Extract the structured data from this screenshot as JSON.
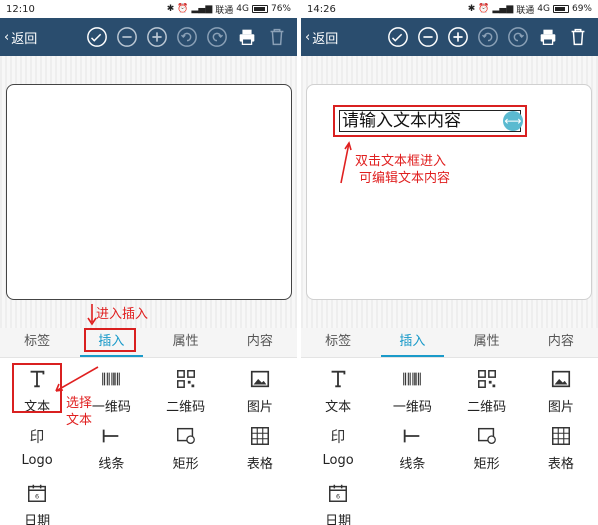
{
  "left": {
    "status": {
      "time": "12:10",
      "carrier": "联通",
      "net": "4G",
      "battery": "76%",
      "battery_level": 0.76
    },
    "topbar": {
      "back_label": "返回"
    },
    "tabs": [
      "标签",
      "插入",
      "属性",
      "内容"
    ],
    "active_tab": 1,
    "items": [
      "文本",
      "一维码",
      "二维码",
      "图片",
      "Logo",
      "线条",
      "矩形",
      "表格",
      "日期"
    ],
    "annotations": {
      "enter_insert": "进入插入",
      "select_text_line1": "选择",
      "select_text_line2": "文本"
    }
  },
  "right": {
    "status": {
      "time": "14:26",
      "carrier": "联通",
      "net": "4G",
      "battery": "69%",
      "battery_level": 0.69
    },
    "topbar": {
      "back_label": "返回"
    },
    "tabs": [
      "标签",
      "插入",
      "属性",
      "内容"
    ],
    "active_tab": 1,
    "items": [
      "文本",
      "一维码",
      "二维码",
      "图片",
      "Logo",
      "线条",
      "矩形",
      "表格",
      "日期"
    ],
    "textbox_placeholder": "请输入文本内容",
    "annotations": {
      "line1": "双击文本框进入",
      "line2": "可编辑文本内容"
    }
  },
  "colors": {
    "topbar": "#2a4d6e",
    "accent": "#1a9ac9",
    "annotation": "#e02020"
  }
}
